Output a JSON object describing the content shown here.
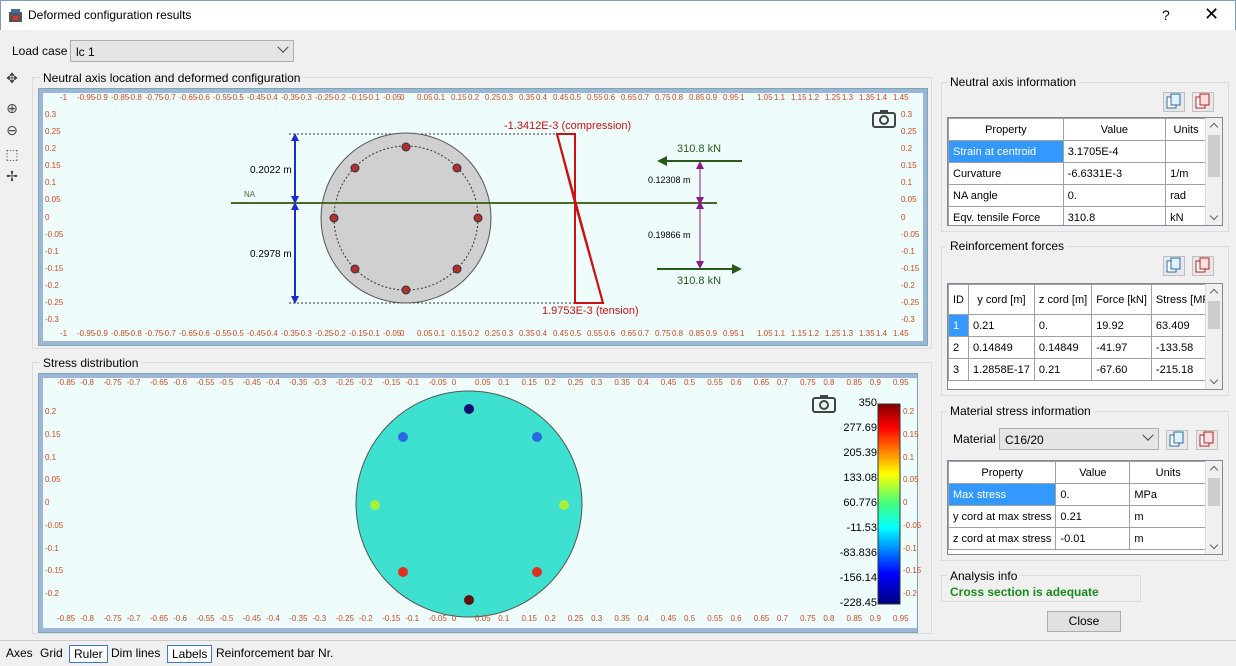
{
  "window": {
    "title": "Deformed configuration results",
    "help": "?",
    "close": "✕"
  },
  "loadcase": {
    "label": "Load case",
    "value": "lc 1"
  },
  "tools": [
    "pan-icon",
    "zoom-in-icon",
    "zoom-out-icon",
    "zoom-window-icon",
    "zoom-fit-icon"
  ],
  "top_plot": {
    "title": "Neutral axis location and deformed configuration",
    "compression": "-1.3412E-3 (compression)",
    "tension": "1.9753E-3 (tension)",
    "dim_upper": "0.2022 m",
    "dim_lower": "0.2978 m",
    "na": "NA",
    "force_top": "310.8 kN",
    "force_bottom": "310.8 kN",
    "arm_upper": "0.12308 m",
    "arm_lower": "0.19866 m",
    "xticks": [
      "-1",
      "-0.95",
      "-0.9",
      "-0.85",
      "-0.8",
      "-0.75",
      "-0.7",
      "-0.65",
      "-0.6",
      "-0.55",
      "-0.5",
      "-0.45",
      "-0.4",
      "-0.35",
      "-0.3",
      "-0.25",
      "-0.2",
      "-0.15",
      "-0.1",
      "-0.05",
      "0",
      "0.05",
      "0.1",
      "0.15",
      "0.2",
      "0.25",
      "0.3",
      "0.35",
      "0.4",
      "0.45",
      "0.5",
      "0.55",
      "0.6",
      "0.65",
      "0.7",
      "0.75",
      "0.8",
      "0.85",
      "0.9",
      "0.95",
      "1",
      "1.05",
      "1.1",
      "1.15",
      "1.2",
      "1.25",
      "1.3",
      "1.35",
      "1.4",
      "1.45"
    ],
    "yticks": [
      "0.3",
      "0.25",
      "0.2",
      "0.15",
      "0.1",
      "0.05",
      "0",
      "-0.05",
      "-0.1",
      "-0.15",
      "-0.2",
      "-0.25",
      "-0.3"
    ]
  },
  "bottom_plot": {
    "title": "Stress distribution",
    "xticks": [
      "-0.85",
      "-0.8",
      "-0.75",
      "-0.7",
      "-0.65",
      "-0.6",
      "-0.55",
      "-0.5",
      "-0.45",
      "-0.4",
      "-0.35",
      "-0.3",
      "-0.25",
      "-0.2",
      "-0.15",
      "-0.1",
      "-0.05",
      "0",
      "0.05",
      "0.1",
      "0.15",
      "0.2",
      "0.25",
      "0.3",
      "0.35",
      "0.4",
      "0.45",
      "0.5",
      "0.55",
      "0.6",
      "0.65",
      "0.7",
      "0.75",
      "0.8",
      "0.85",
      "0.9",
      "0.95"
    ],
    "yticks": [
      "0.2",
      "0.15",
      "0.1",
      "0.05",
      "0",
      "-0.05",
      "-0.1",
      "-0.15",
      "-0.2"
    ],
    "legend_values": [
      "350",
      "277.69",
      "205.39",
      "133.08",
      "60.776",
      "-11.53",
      "-83.836",
      "-156.14",
      "-228.45"
    ],
    "legend_inner": [
      "0.2",
      "0.15",
      "0.1",
      "0.05",
      "0",
      "-0.05",
      "-0.1",
      "-0.15",
      "-0.2"
    ]
  },
  "neutral_axis_info": {
    "title": "Neutral axis information",
    "headers": [
      "Property",
      "Value",
      "Units"
    ],
    "rows": [
      [
        "Strain at centroid",
        "3.1705E-4",
        ""
      ],
      [
        "Curvature",
        "-6.6331E-3",
        "1/m"
      ],
      [
        "NA angle",
        "0.",
        "rad"
      ],
      [
        "Eqv. tensile Force",
        "310.8",
        "kN"
      ]
    ]
  },
  "reinforcement_forces": {
    "title": "Reinforcement forces",
    "headers": [
      "ID",
      "y cord [m]",
      "z cord [m]",
      "Force [kN]",
      "Stress [MPa]"
    ],
    "rows": [
      [
        "1",
        "0.21",
        "0.",
        "19.92",
        "63.409"
      ],
      [
        "2",
        "0.14849",
        "0.14849",
        "-41.97",
        "-133.58"
      ],
      [
        "3",
        "1.2858E-17",
        "0.21",
        "-67.60",
        "-215.18"
      ]
    ]
  },
  "material_stress": {
    "title": "Material stress information",
    "material_label": "Material",
    "material_value": "C16/20",
    "headers": [
      "Property",
      "Value",
      "Units"
    ],
    "rows": [
      [
        "Max stress",
        "0.",
        "MPa"
      ],
      [
        "y cord at max stress",
        "0.21",
        "m"
      ],
      [
        "z cord at max stress",
        "-0.01",
        "m"
      ]
    ]
  },
  "analysis": {
    "title": "Analysis info",
    "message": "Cross section is adequate",
    "color": "#1a8a1a"
  },
  "close_button": "Close",
  "statusbar": [
    "Axes",
    "Grid",
    "Ruler",
    "Dim lines",
    "Labels",
    "Reinforcement bar Nr."
  ]
}
